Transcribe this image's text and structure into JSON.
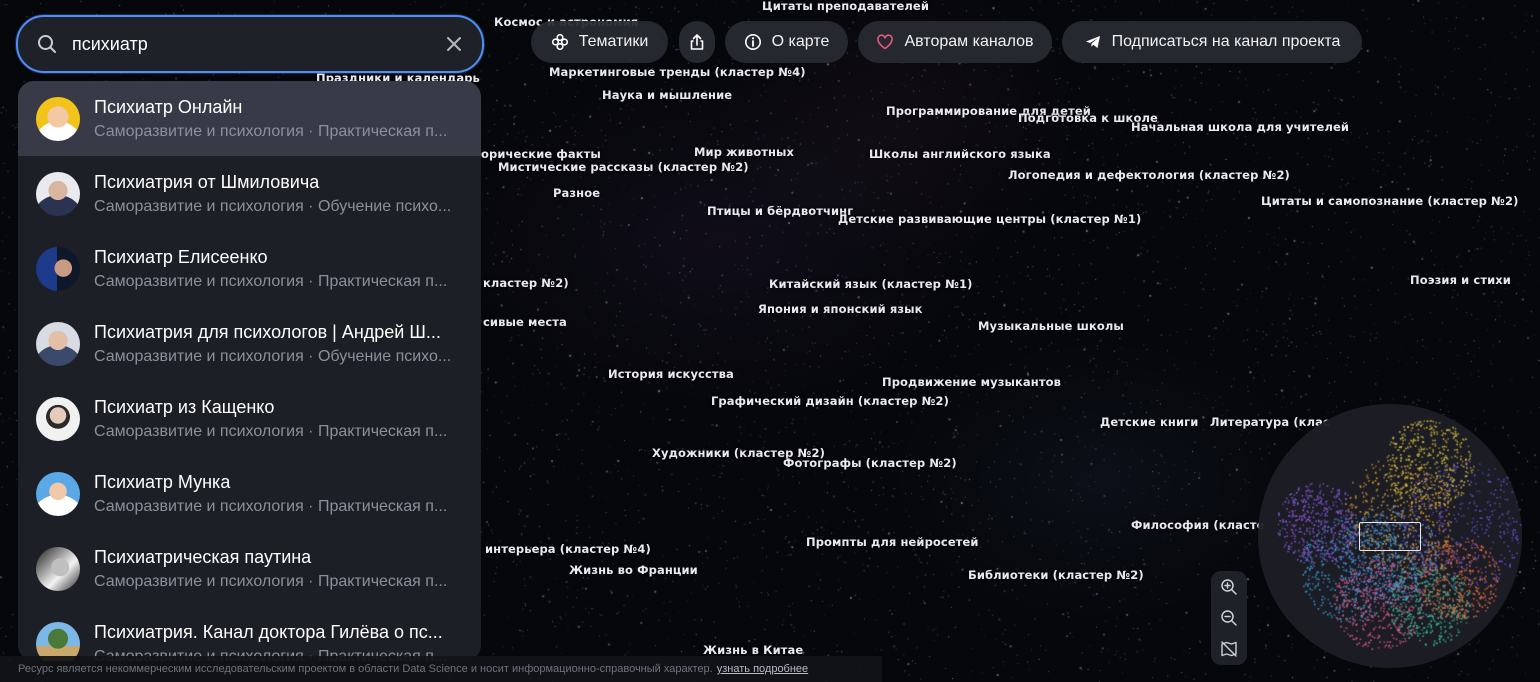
{
  "search": {
    "value": "психиатр",
    "results": [
      {
        "title": "Психиатр Онлайн",
        "subtitle": "Саморазвитие и психология · Практическая п..."
      },
      {
        "title": "Психиатрия от Шмиловича",
        "subtitle": "Саморазвитие и психология · Обучение психо..."
      },
      {
        "title": "Психиатр Елисеенко",
        "subtitle": "Саморазвитие и психология · Практическая п..."
      },
      {
        "title": "Психиатрия для психологов | Андрей Ш...",
        "subtitle": "Саморазвитие и психология · Обучение психо..."
      },
      {
        "title": "Психиатр из Кащенко",
        "subtitle": "Саморазвитие и психология · Практическая п..."
      },
      {
        "title": "Психиатр Мунка",
        "subtitle": "Саморазвитие и психология · Практическая п..."
      },
      {
        "title": "Психиатрическая паутина",
        "subtitle": "Саморазвитие и психология · Практическая п..."
      },
      {
        "title": "Психиатрия. Канал доктора Гилёва о пс...",
        "subtitle": "Саморазвитие и психология · Практическая п..."
      }
    ]
  },
  "toolbar": {
    "topics": "Тематики",
    "about": "О карте",
    "authors": "Авторам каналов",
    "subscribe": "Подписаться на канал проекта"
  },
  "map_labels": [
    "Цитаты преподавателей",
    "Космос и астрономия",
    "Праздники и календарь",
    "Маркетинговые тренды (кластер №4)",
    "Наука и мышление",
    "Программирование для детей",
    "Подготовка к школе",
    "Начальная школа для учителей",
    "Мир животных",
    "Школы английского языка",
    "орические факты",
    "Мистические рассказы (кластер №2)",
    "Логопедия и дефектология (кластер №2)",
    "Разное",
    "Цитаты и самопознание (кластер №2)",
    "Птицы и бёрдвотчинг",
    "Детские развивающие центры (кластер №1)",
    "Китайский язык (кластер №1)",
    "кластер №2)",
    "Поэзия и стихи",
    "Япония и японский язык",
    "сивые места",
    "Музыкальные школы",
    "История искусства",
    "Продвижение музыкантов",
    "Графический дизайн (кластер №2)",
    "Детские книги",
    "Литература (клас",
    "Художники (кластер №2)",
    "Фотографы (кластер №2)",
    "Философия (класте",
    "Промпты для нейросетей",
    "интерьера (кластер №4)",
    "Жизнь во Франции",
    "Библиотеки (кластер №2)",
    "Жизнь в Китае"
  ],
  "footer": {
    "text": "Ресурс является некоммерческим исследовательским проектом в области Data Science и носит информационно-справочный характер.",
    "link": "узнать подробнее"
  },
  "colors": {
    "accent": "#4f8ef7",
    "background": "#06070b",
    "panel": "#1e2028",
    "heart": "#e8577e"
  }
}
